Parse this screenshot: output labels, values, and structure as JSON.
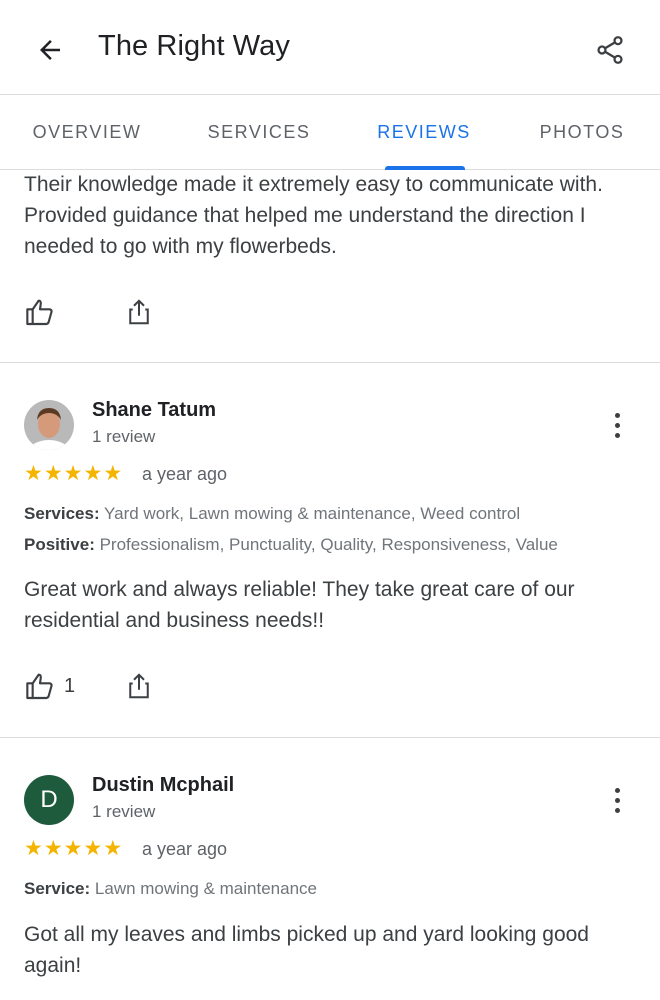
{
  "appbar": {
    "title": "The Right Way"
  },
  "tabs": [
    {
      "label": "OVERVIEW"
    },
    {
      "label": "SERVICES"
    },
    {
      "label": "REVIEWS"
    },
    {
      "label": "PHOTOS"
    }
  ],
  "active_tab": "REVIEWS",
  "accent_color": "#1a73e8",
  "star_color": "#f4b400",
  "partial_review": {
    "text": "Their knowledge made it extremely easy to communicate with. Provided guidance that helped me understand the direction I needed to go with my flowerbeds."
  },
  "reviews": [
    {
      "name": "Shane Tatum",
      "review_count": "1 review",
      "rating": 5,
      "time": "a year ago",
      "meta1_label": "Services:",
      "meta1_value": "Yard work, Lawn mowing & maintenance, Weed control",
      "meta2_label": "Positive:",
      "meta2_value": "Professionalism, Punctuality, Quality, Responsiveness, Value",
      "text": "Great work and always reliable! They take great care of our residential and business needs!!",
      "likes": "1"
    },
    {
      "name": "Dustin Mcphail",
      "avatar_initial": "D",
      "avatar_color": "#1e5a3c",
      "review_count": "1 review",
      "rating": 5,
      "time": "a year ago",
      "meta1_label": "Service:",
      "meta1_value": "Lawn mowing & maintenance",
      "text": "Got all my leaves and limbs picked up and yard looking good again!"
    }
  ]
}
